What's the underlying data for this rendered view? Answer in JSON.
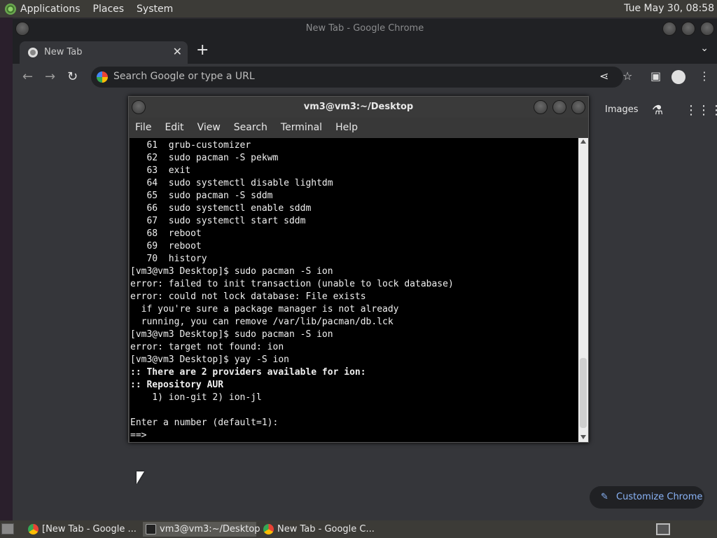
{
  "top_panel": {
    "menus": [
      "Applications",
      "Places",
      "System"
    ],
    "clock": "Tue May 30, 08:58"
  },
  "chrome": {
    "window_title": "New Tab - Google Chrome",
    "tab_title": "New Tab",
    "omnibox_placeholder": "Search Google or type a URL",
    "ntp_images": "Images",
    "customize_label": "Customize Chrome"
  },
  "terminal": {
    "title": "vm3@vm3:~/Desktop",
    "menus": [
      "File",
      "Edit",
      "View",
      "Search",
      "Terminal",
      "Help"
    ],
    "lines": [
      {
        "text": "   61  grub-customizer",
        "bold": false
      },
      {
        "text": "   62  sudo pacman -S pekwm",
        "bold": false
      },
      {
        "text": "   63  exit",
        "bold": false
      },
      {
        "text": "   64  sudo systemctl disable lightdm",
        "bold": false
      },
      {
        "text": "   65  sudo pacman -S sddm",
        "bold": false
      },
      {
        "text": "   66  sudo systemctl enable sddm",
        "bold": false
      },
      {
        "text": "   67  sudo systemctl start sddm",
        "bold": false
      },
      {
        "text": "   68  reboot",
        "bold": false
      },
      {
        "text": "   69  reboot",
        "bold": false
      },
      {
        "text": "   70  history",
        "bold": false
      },
      {
        "text": "[vm3@vm3 Desktop]$ sudo pacman -S ion",
        "bold": false
      },
      {
        "text": "error: failed to init transaction (unable to lock database)",
        "bold": false
      },
      {
        "text": "error: could not lock database: File exists",
        "bold": false
      },
      {
        "text": "  if you're sure a package manager is not already",
        "bold": false
      },
      {
        "text": "  running, you can remove /var/lib/pacman/db.lck",
        "bold": false
      },
      {
        "text": "[vm3@vm3 Desktop]$ sudo pacman -S ion",
        "bold": false
      },
      {
        "text": "error: target not found: ion",
        "bold": false
      },
      {
        "text": "[vm3@vm3 Desktop]$ yay -S ion",
        "bold": false
      },
      {
        "text": ":: There are 2 providers available for ion:",
        "bold": true
      },
      {
        "text": ":: Repository AUR",
        "bold": true
      },
      {
        "text": "    1) ion-git 2) ion-jl",
        "bold": false
      },
      {
        "text": "",
        "bold": false
      },
      {
        "text": "Enter a number (default=1):",
        "bold": false
      },
      {
        "text": "==>",
        "bold": false
      }
    ]
  },
  "taskbar": {
    "tasks": [
      {
        "label": "[New Tab - Google ...",
        "icon": "chrome-icon"
      },
      {
        "label": "vm3@vm3:~/Desktop",
        "icon": "terminal-icon"
      },
      {
        "label": "New Tab - Google C...",
        "icon": "chrome-icon"
      }
    ]
  }
}
